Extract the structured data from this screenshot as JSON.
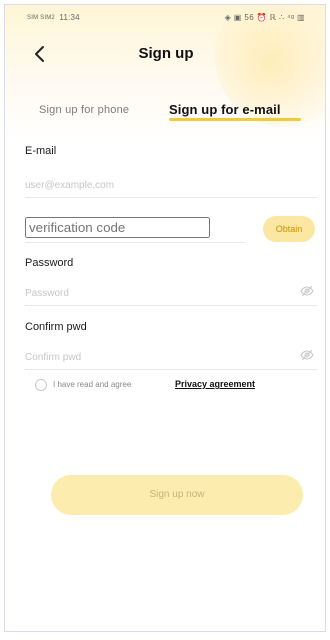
{
  "status": {
    "carrier": "SIM\nSIM2",
    "time": "11:34",
    "icons": "◈ ▣ 56 ⏰ ℝ ∴ ⁴ᵍ ▥"
  },
  "header": {
    "title": "Sign up"
  },
  "tabs": {
    "phone_label": "Sign up for phone",
    "email_label": "Sign up for e-mail"
  },
  "form": {
    "email": {
      "label": "E-mail",
      "placeholder": "user@example.com",
      "value": ""
    },
    "verification": {
      "placeholder": "verification code",
      "value": "",
      "obtain_label": "Obtain"
    },
    "password": {
      "label": "Password",
      "placeholder": "Password",
      "value": ""
    },
    "confirm": {
      "label": "Confirm pwd",
      "placeholder": "Confirm pwd",
      "value": ""
    }
  },
  "agreement": {
    "text": "I have read and agree",
    "link": "Privacy agreement",
    "checked": false
  },
  "actions": {
    "signup_label": "Sign up now"
  },
  "colors": {
    "accent": "#f3c93a",
    "button_bg": "#fcedae",
    "obtain_text": "#c79500"
  },
  "icons": {
    "back": "chevron-left-icon",
    "password_toggle": "eye-off-icon"
  }
}
